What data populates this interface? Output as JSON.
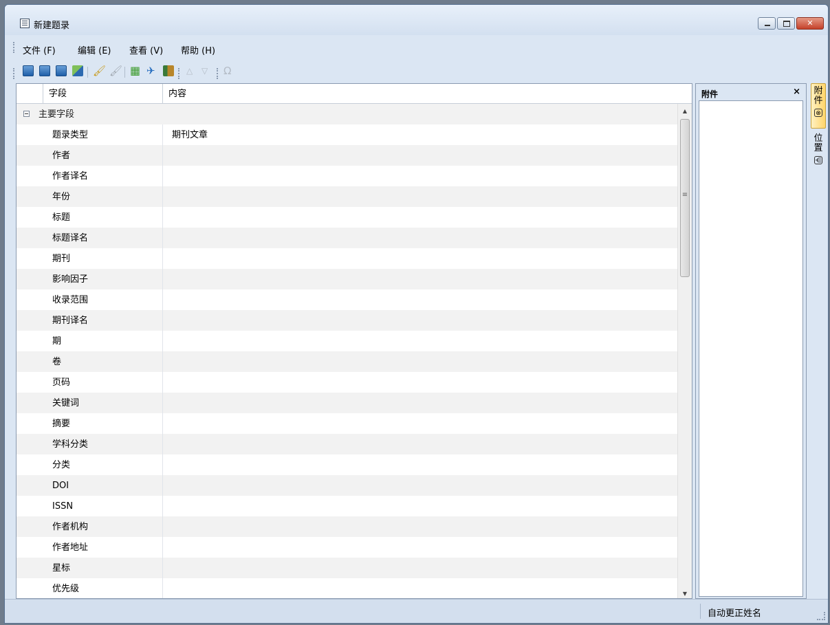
{
  "window": {
    "title": "新建题录"
  },
  "menu": [
    "文件 (F)",
    "编辑 (E)",
    "查看 (V)",
    "帮助 (H)"
  ],
  "grid": {
    "headers": {
      "field": "字段",
      "content": "内容"
    },
    "group_label": "主要字段",
    "rows": [
      {
        "field": "题录类型",
        "value": "期刊文章"
      },
      {
        "field": "作者",
        "value": ""
      },
      {
        "field": "作者译名",
        "value": ""
      },
      {
        "field": "年份",
        "value": ""
      },
      {
        "field": "标题",
        "value": ""
      },
      {
        "field": "标题译名",
        "value": ""
      },
      {
        "field": "期刊",
        "value": ""
      },
      {
        "field": "影响因子",
        "value": ""
      },
      {
        "field": "收录范围",
        "value": ""
      },
      {
        "field": "期刊译名",
        "value": ""
      },
      {
        "field": "期",
        "value": ""
      },
      {
        "field": "卷",
        "value": ""
      },
      {
        "field": "页码",
        "value": ""
      },
      {
        "field": "关键词",
        "value": ""
      },
      {
        "field": "摘要",
        "value": ""
      },
      {
        "field": "学科分类",
        "value": ""
      },
      {
        "field": "分类",
        "value": ""
      },
      {
        "field": "DOI",
        "value": ""
      },
      {
        "field": "ISSN",
        "value": ""
      },
      {
        "field": "作者机构",
        "value": ""
      },
      {
        "field": "作者地址",
        "value": ""
      },
      {
        "field": "星标",
        "value": ""
      },
      {
        "field": "优先级",
        "value": ""
      }
    ]
  },
  "attach_panel": {
    "title": "附件",
    "close": "×"
  },
  "side_tabs": [
    {
      "label": "附件",
      "icon": "paperclip-icon",
      "icon_glyph": "⊗"
    },
    {
      "label": "位置",
      "icon": "location-icon",
      "icon_glyph": "⋲"
    }
  ],
  "status": {
    "text": "自动更正姓名"
  },
  "toolbar_icons": [
    "new-icon",
    "save-icon",
    "save-close-icon",
    "save-as-icon",
    "clear-icon",
    "clear-gray-icon",
    "grid-icon",
    "pin-icon",
    "flag-icon",
    "move-up-icon",
    "move-down-icon",
    "omega-icon"
  ],
  "toolbar_glyphs": {
    "broom": "🖌",
    "gray": "🖌",
    "grid": "▦",
    "pin": "✈",
    "up": "△",
    "down": "▽",
    "omega": "Ω"
  }
}
